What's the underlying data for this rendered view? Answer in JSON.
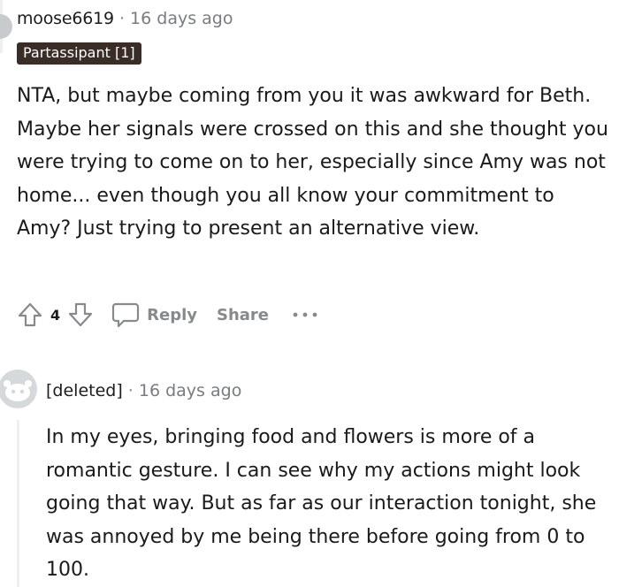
{
  "comment1": {
    "username": "moose6619",
    "separator": "·",
    "time": "16 days ago",
    "flair": "Partassipant [1]",
    "body": "NTA, but maybe coming from you it was awkward for Beth. Maybe her signals were crossed on this and she thought you were trying to come on to her, especially since Amy was not home... even though you all know your commitment to Amy? Just trying to present an alternative view.",
    "actions": {
      "upvote_icon": "upvote-arrow-icon",
      "vote_count": "4",
      "downvote_icon": "downvote-arrow-icon",
      "comment_icon": "speech-bubble-icon",
      "reply_label": "Reply",
      "share_label": "Share",
      "more_icon": "ellipsis-icon"
    }
  },
  "comment2": {
    "username": "[deleted]",
    "separator": "·",
    "time": "16 days ago",
    "avatar_icon": "default-avatar-icon",
    "body": "In my eyes, bringing food and flowers is more of a romantic gesture. I can see why my actions might look going that way. But as far as our interaction tonight, she was annoyed by me being there before going from 0 to 100."
  },
  "colors": {
    "flair_bg": "#3a2c26",
    "meta_gray": "#787c7e",
    "action_gray": "#878a8c",
    "thread_line": "#edeff1"
  }
}
